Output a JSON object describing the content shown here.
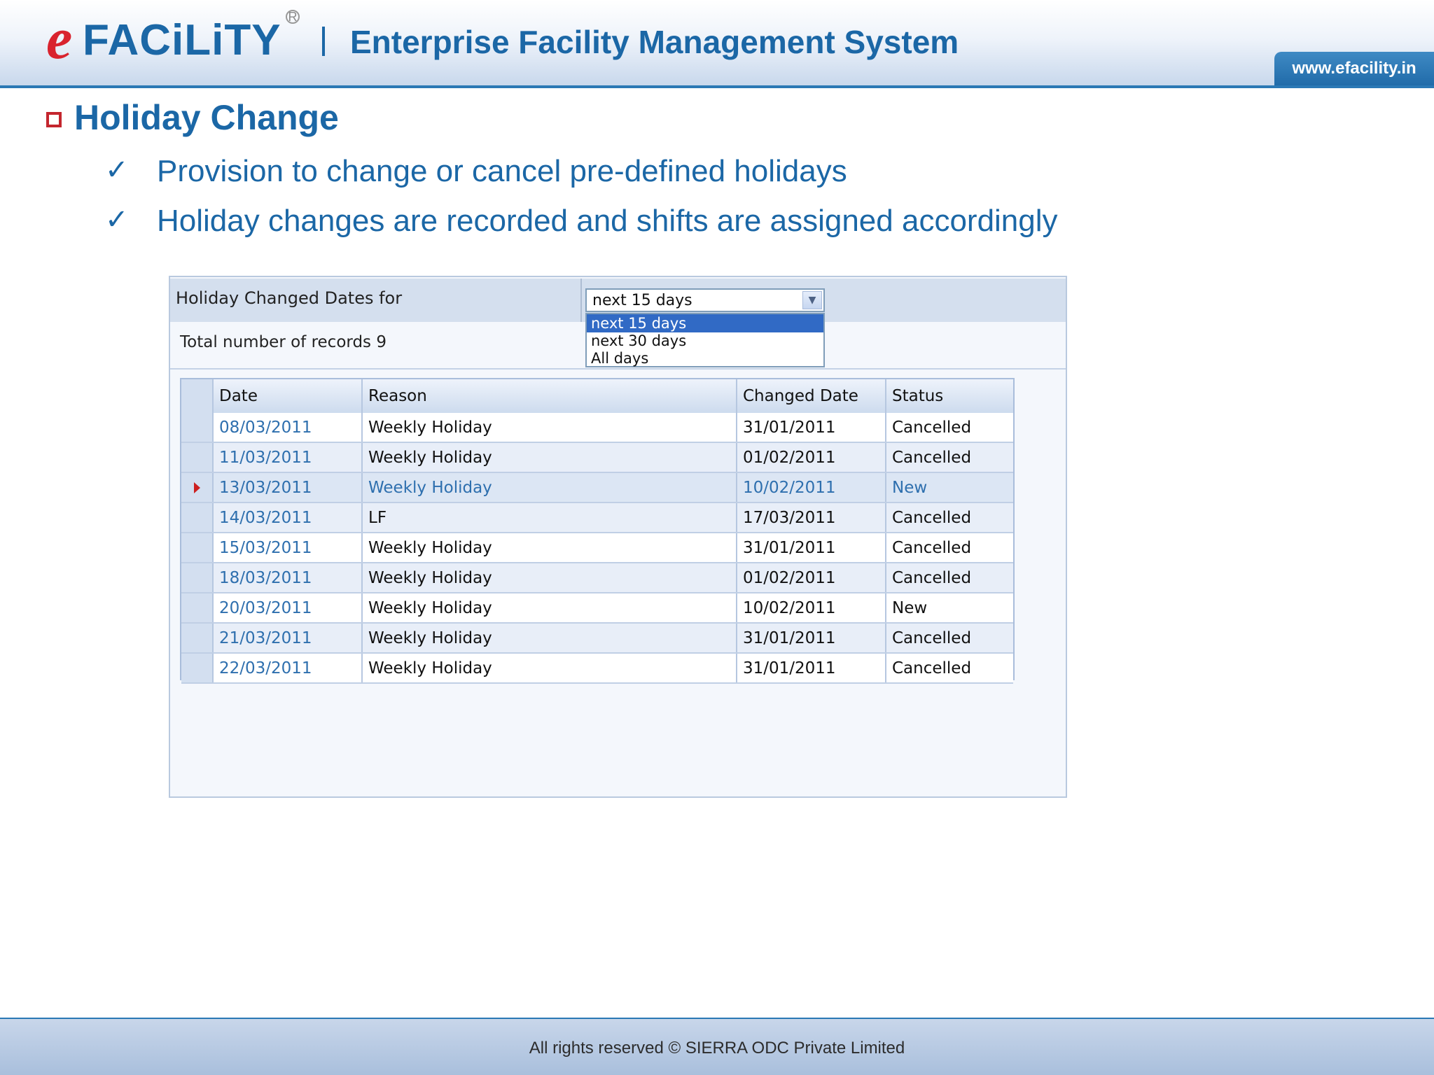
{
  "header": {
    "logo_e": "e",
    "logo_rest": "FACiLiTY",
    "logo_reg": "R",
    "title": "Enterprise Facility Management System",
    "url": "www.efacility.in"
  },
  "slide": {
    "title": "Holiday Change",
    "bullets": [
      "Provision to change or cancel pre-defined holidays",
      "Holiday changes are recorded and shifts are assigned accordingly"
    ],
    "check_glyph": "✓"
  },
  "app": {
    "filter_label": "Holiday Changed Dates for",
    "filter_select": {
      "value": "next 15 days",
      "options": [
        "next 15 days",
        "next 30 days",
        "All days"
      ],
      "selected_index": 0
    },
    "records_label": "Total number of records 9",
    "grid": {
      "columns": [
        "Date",
        "Reason",
        "Changed Date",
        "Status"
      ],
      "active_row": 2,
      "rows": [
        [
          "08/03/2011",
          "Weekly Holiday",
          "31/01/2011",
          "Cancelled"
        ],
        [
          "11/03/2011",
          "Weekly Holiday",
          "01/02/2011",
          "Cancelled"
        ],
        [
          "13/03/2011",
          "Weekly Holiday",
          "10/02/2011",
          "New"
        ],
        [
          "14/03/2011",
          "LF",
          "17/03/2011",
          "Cancelled"
        ],
        [
          "15/03/2011",
          "Weekly Holiday",
          "31/01/2011",
          "Cancelled"
        ],
        [
          "18/03/2011",
          "Weekly Holiday",
          "01/02/2011",
          "Cancelled"
        ],
        [
          "20/03/2011",
          "Weekly Holiday",
          "10/02/2011",
          "New"
        ],
        [
          "21/03/2011",
          "Weekly Holiday",
          "31/01/2011",
          "Cancelled"
        ],
        [
          "22/03/2011",
          "Weekly Holiday",
          "31/01/2011",
          "Cancelled"
        ]
      ]
    }
  },
  "footer": {
    "text": "All rights reserved © SIERRA ODC Private Limited"
  },
  "colors": {
    "brand_blue": "#1b67a6",
    "brand_red": "#d9232e",
    "selection_blue": "#316ac5"
  }
}
